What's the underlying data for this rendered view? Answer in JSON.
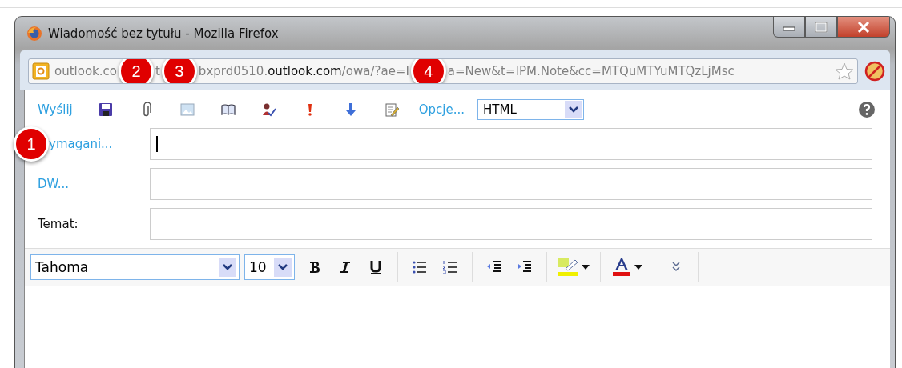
{
  "window": {
    "title": "Wiadomość bez tytułu - Mozilla Firefox"
  },
  "address_bar": {
    "items": [
      {
        "kind": "text",
        "text": "outlook.co",
        "emphasized": false
      },
      {
        "kind": "badge",
        "number": "2"
      },
      {
        "kind": "text",
        "text": "t",
        "emphasized": false
      },
      {
        "kind": "badge",
        "number": "3"
      },
      {
        "kind": "text",
        "text": "bxprd0510.",
        "emphasized": false
      },
      {
        "kind": "text",
        "text": "outlook.com",
        "emphasized": true
      },
      {
        "kind": "text",
        "text": "/owa/?ae=I",
        "emphasized": false
      },
      {
        "kind": "badge",
        "number": "4"
      },
      {
        "kind": "text",
        "text": "a=New&t=IPM.Note&cc=MTQuMTYuMTQzLjMsc",
        "emphasized": false
      }
    ]
  },
  "toolbar": {
    "send": "Wyślij",
    "options": "Opcje...",
    "format": "HTML"
  },
  "fields": [
    {
      "label": "ymagani...",
      "kind": "link",
      "badge": "1",
      "focused": true
    },
    {
      "label": "DW...",
      "kind": "link",
      "focused": false
    },
    {
      "label": "Temat:",
      "kind": "plain",
      "focused": false
    }
  ],
  "format_bar": {
    "font": "Tahoma",
    "size": "10"
  }
}
